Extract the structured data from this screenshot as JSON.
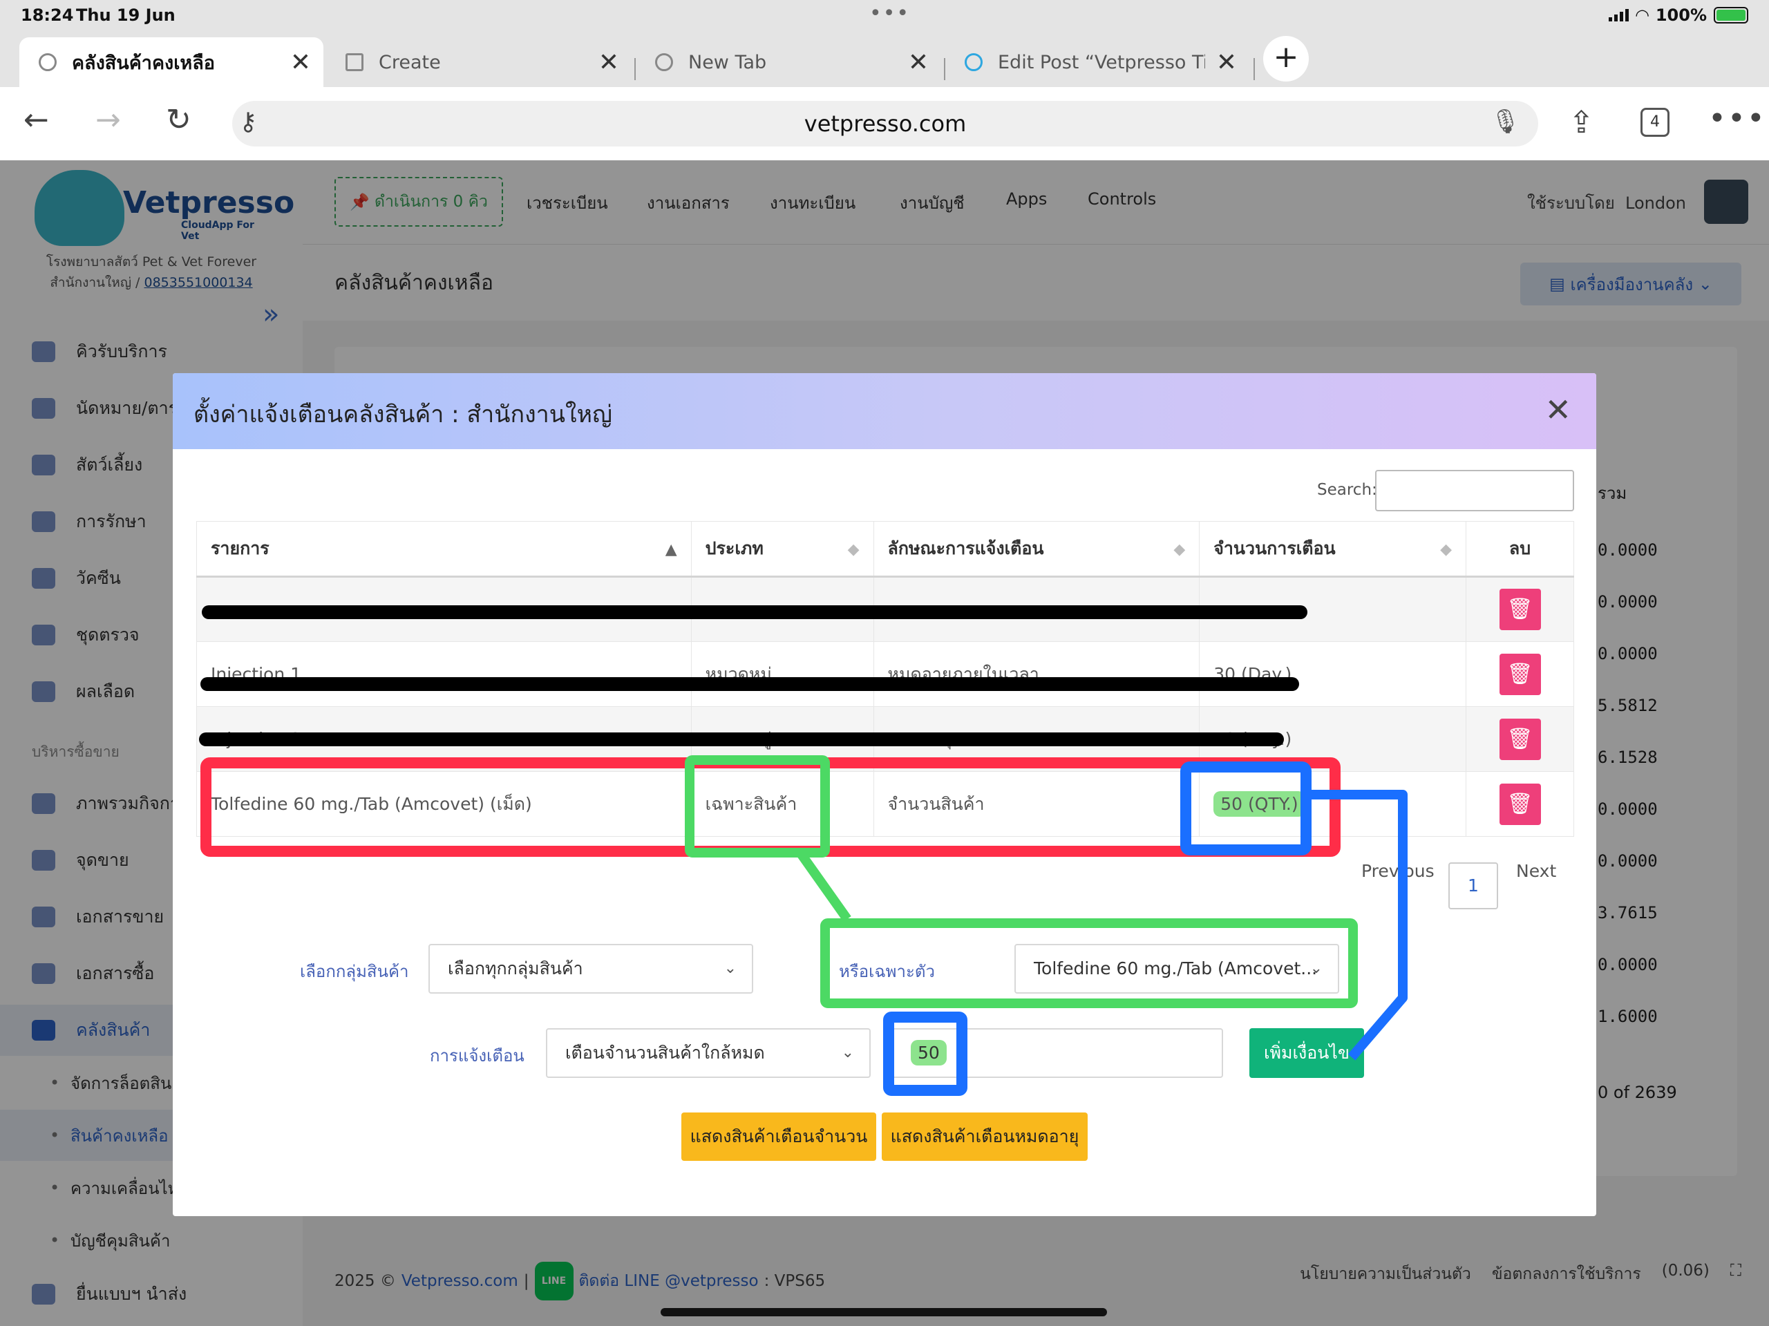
{
  "status": {
    "time": "18:24",
    "date": "Thu 19 Jun",
    "battery": "100%"
  },
  "browser": {
    "tabs": [
      "คลังสินค้าคงเหลือ",
      "Create",
      "New Tab",
      "Edit Post “Vetpresso Tip"
    ],
    "url": "vetpresso.com",
    "tab_count": "4"
  },
  "brand": {
    "name": "Vetpresso",
    "sub": "CloudApp For Vet",
    "clinic": "โรงพยาบาลสัตว์ Pet & Vet Forever",
    "branch": "สำนักงานใหญ่ /",
    "phone": "0853551000134"
  },
  "sidebar": {
    "items": [
      "คิวรับบริการ",
      "นัดหมาย/ตาร",
      "สัตว์เลี้ยง",
      "การรักษา",
      "วัคซีน",
      "ชุดตรวจ",
      "ผลเลือด"
    ],
    "section": "บริหารซื้อขาย",
    "items2": [
      "ภาพรวมกิจกา",
      "จุดขาย",
      "เอกสารขาย",
      "เอกสารซื้อ",
      "คลังสินค้า"
    ],
    "subs": [
      "จัดการล็อตสินค",
      "สินค้าคงเหลือ",
      "ความเคลื่อนไห",
      "บัญชีคุมสินค้า"
    ],
    "last": "ยื่นแบบฯ นำส่ง"
  },
  "topnav": {
    "queue": "ดำเนินการ 0 คิว",
    "items": [
      "เวชระเบียน",
      "งานเอกสาร",
      "งานทะเบียน",
      "งานบัญชี",
      "Apps",
      "Controls"
    ],
    "user_label": "ใช้ระบบโดย",
    "user": "London"
  },
  "page": {
    "title": "คลังสินค้าคงเหลือ",
    "tools": "เครื่องมืองานคลัง"
  },
  "background_values": {
    "col_header": "รวม",
    "values": [
      "0.0000",
      "0.0000",
      "0.0000",
      "5.5812",
      "6.1528",
      "0.0000",
      "0.0000",
      "3.7615",
      "0.0000",
      "1.6000"
    ],
    "footer": "0 of 2639"
  },
  "modal": {
    "title": "ตั้งค่าแจ้งเตือนคลังสินค้า : สำนักงานใหญ่",
    "search_label": "Search:",
    "columns": [
      "รายการ",
      "ประเภท",
      "ลักษณะการแจ้งเตือน",
      "จำนวนการเตือน",
      "ลบ"
    ],
    "rows": [
      {
        "item": "",
        "type": "",
        "mode": "",
        "qty": ""
      },
      {
        "item": "Injection 1",
        "type": "หมวดหมู่",
        "mode": "หมดอายุภายในเวลา",
        "qty": "30 (Day.)"
      },
      {
        "item": "Injection 2",
        "type": "หมวดหมู่",
        "mode": "หมดอายุ",
        "qty": "10 (Day.)"
      },
      {
        "item": "Tolfedine 60 mg./Tab (Amcovet) (เม็ด)",
        "type": "เฉพาะสินค้า",
        "mode": "จำนวนสินค้า",
        "qty": "50 (QTY.)"
      }
    ],
    "pager": {
      "prev": "Previous",
      "page": "1",
      "next": "Next"
    },
    "group_label": "เลือกกลุ่มสินค้า",
    "group_value": "เลือกทุกกลุ่มสินค้า",
    "or_label": "หรือเฉพาะตัว",
    "product_value": "Tolfedine 60 mg./Tab (Amcovet...",
    "alert_label": "การแจ้งเตือน",
    "alert_value": "เตือนจำนวนสินค้าใกล้หมด",
    "qty_value": "50",
    "add_btn": "เพิ่มเงื่อนไข",
    "btn_qty": "แสดงสินค้าเตือนจำนวน",
    "btn_exp": "แสดงสินค้าเตือนหมดอายุ"
  },
  "footer": {
    "year": "2025 ©",
    "site": "Vetpresso.com",
    "line": "ติดต่อ LINE @vetpresso",
    "server": ": VPS65",
    "privacy": "นโยบายความเป็นส่วนตัว",
    "terms": "ข้อตกลงการใช้บริการ",
    "version": "(0.06)"
  },
  "colors": {
    "red": "#ff2d48",
    "green": "#4cd964",
    "blue": "#1a6fff",
    "accent": "#2e63c6",
    "delete": "#ee3f7a"
  }
}
